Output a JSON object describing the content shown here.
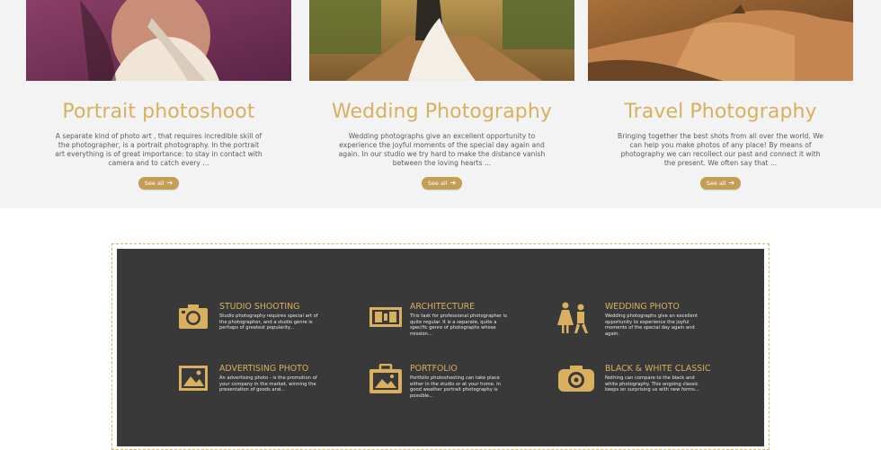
{
  "cards": [
    {
      "title": "Portrait photoshoot",
      "text": "A separate kind of photo art , that requires incredible skill of the photographer, is a portrait photography. In the portrait art everything is of great importance: to stay in contact with camera and to catch every ...",
      "button": "See all"
    },
    {
      "title": "Wedding Photography",
      "text": "Wedding photographs give an excellent opportunity to experience the joyful moments of the special day again and again. In our studio we try hard to make the distance vanish between the loving hearts ...",
      "button": "See all"
    },
    {
      "title": "Travel Photography",
      "text": "Bringing together the best shots from all over the world. We can help you make photos of any place! By means of photography we can recollect our past and connect it with the present. We often say that ...",
      "button": "See all"
    }
  ],
  "services": [
    {
      "title": "STUDIO SHOOTING",
      "text": "Studio photography requires special art of the photographer, and a studio genre is perhaps of greatest popularity...",
      "icon": "camera-icon"
    },
    {
      "title": "ARCHITECTURE",
      "text": "This task for professional photographer is quite regular. It is a separate, quite a specific genre of photographs whose mission...",
      "icon": "building-icon"
    },
    {
      "title": "WEDDING PHOTO",
      "text": "Wedding photographs give an excellent opportunity to experience the joyful moments of the special day again and again.",
      "icon": "couple-icon"
    },
    {
      "title": "ADVERTISING PHOTO",
      "text": "An advertising photo - is the promotion of your company in the market, winning the presentation of goods and...",
      "icon": "picture-icon"
    },
    {
      "title": "PORTFOLIO",
      "text": "Portfolio photoshooting can take place either in the studio or at your home. In good weather portrait photography is possible...",
      "icon": "portfolio-icon"
    },
    {
      "title": "BLACK & WHITE CLASSIC",
      "text": "Nothing can compare to the black and white photography. This ongoing classic keeps on surprising us with new forms...",
      "icon": "retro-camera-icon"
    }
  ],
  "colors": {
    "accent": "#d8b05f",
    "button": "#c39f54",
    "dark_panel": "#3a3939",
    "top_background": "#f3f3f3"
  }
}
